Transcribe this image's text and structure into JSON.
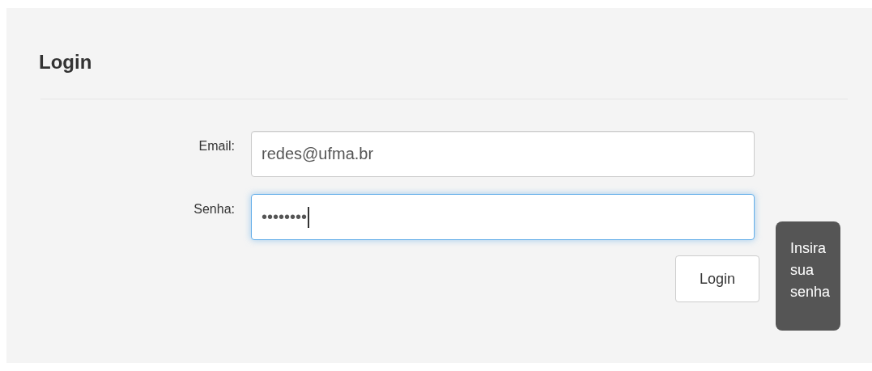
{
  "title": "Login",
  "fields": [
    {
      "label": "Email:",
      "value": "redes@ufma.br",
      "focused": false
    },
    {
      "label": "Senha:",
      "value": "••••••••",
      "focused": true
    }
  ],
  "button": "Login",
  "tooltip": "Insira sua senha"
}
